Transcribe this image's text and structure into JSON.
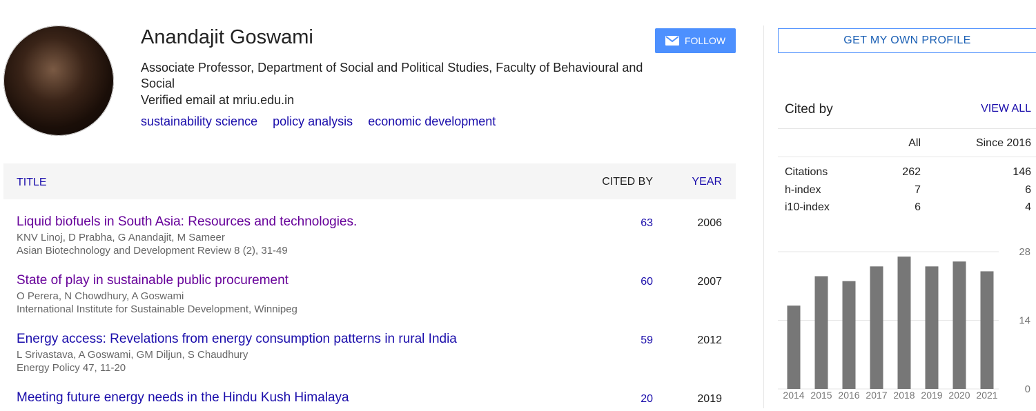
{
  "profile": {
    "name": "Anandajit Goswami",
    "affiliation": "Associate Professor, Department of Social and Political Studies, Faculty of Behavioural and Social",
    "email": "Verified email at mriu.edu.in",
    "interests": [
      "sustainability science",
      "policy analysis",
      "economic development"
    ],
    "follow_label": "FOLLOW"
  },
  "get_profile_label": "GET MY OWN PROFILE",
  "table": {
    "col_title": "TITLE",
    "col_cited": "CITED BY",
    "col_year": "YEAR",
    "rows": [
      {
        "title": "Liquid biofuels in South Asia: Resources and technologies.",
        "authors": "KNV Linoj, D Prabha, G Anandajit, M Sameer",
        "venue": "Asian Biotechnology and Development Review 8 (2), 31-49",
        "cited": "63",
        "year": "2006",
        "visited": true
      },
      {
        "title": "State of play in sustainable public procurement",
        "authors": "O Perera, N Chowdhury, A Goswami",
        "venue": "International Institute for Sustainable Development, Winnipeg",
        "cited": "60",
        "year": "2007",
        "visited": true
      },
      {
        "title": "Energy access: Revelations from energy consumption patterns in rural India",
        "authors": "L Srivastava, A Goswami, GM Diljun, S Chaudhury",
        "venue": "Energy Policy 47, 11-20",
        "cited": "59",
        "year": "2012",
        "visited": false
      },
      {
        "title": "Meeting future energy needs in the Hindu Kush Himalaya",
        "authors": "",
        "venue": "",
        "cited": "20",
        "year": "2019",
        "visited": false
      }
    ]
  },
  "cited_by": {
    "title": "Cited by",
    "view_all": "VIEW ALL",
    "col_all": "All",
    "col_since": "Since 2016",
    "rows": [
      {
        "label": "Citations",
        "all": "262",
        "since": "146"
      },
      {
        "label": "h-index",
        "all": "7",
        "since": "6"
      },
      {
        "label": "i10-index",
        "all": "6",
        "since": "4"
      }
    ]
  },
  "colors": {
    "link": "#1a0dab",
    "visited": "#660099",
    "button": "#4d90fe",
    "bar": "#777777"
  },
  "chart_data": {
    "type": "bar",
    "categories": [
      "2014",
      "2015",
      "2016",
      "2017",
      "2018",
      "2019",
      "2020",
      "2021"
    ],
    "values": [
      17,
      23,
      22,
      25,
      27,
      25,
      26,
      24
    ],
    "yticks": [
      0,
      14,
      28
    ],
    "ylim": [
      0,
      28
    ],
    "title": "",
    "xlabel": "",
    "ylabel": "",
    "grid": true
  }
}
